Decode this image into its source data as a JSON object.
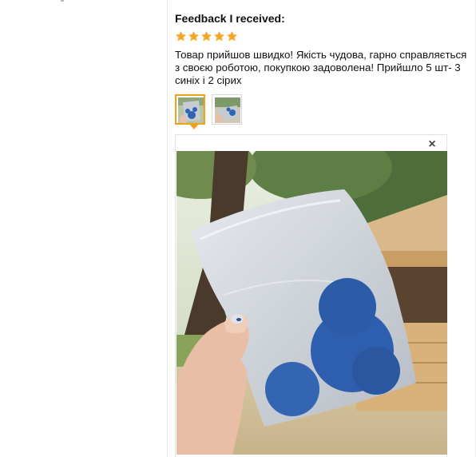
{
  "feedback": {
    "title": "Feedback I received:",
    "rating": 5,
    "rating_max": 5,
    "text": "Товар прийшов швидко! Якість чудова, гарно справляється з своєю роботою, покупкою задоволена! Прийшло 5 шт- 3 синіх і 2 сірих"
  },
  "colors": {
    "star": "#f5a623",
    "thumb_active_border": "#f0a01a"
  },
  "thumbnails": [
    {
      "active": true
    },
    {
      "active": false
    }
  ],
  "viewer": {
    "close_glyph": "×"
  },
  "icons": {
    "star": "star-icon",
    "close": "close-icon"
  }
}
